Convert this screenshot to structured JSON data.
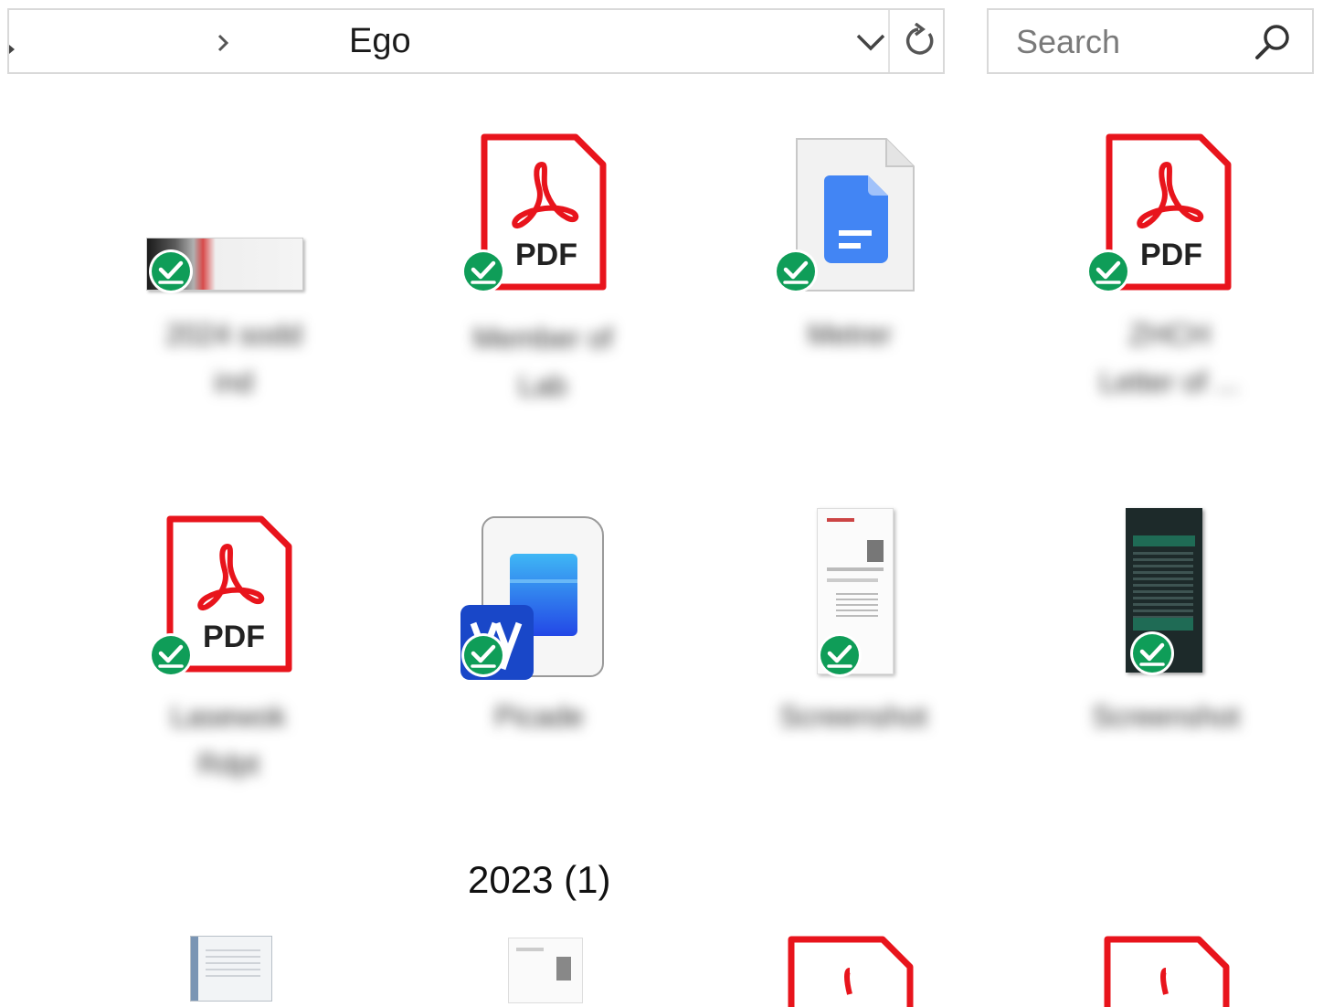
{
  "address": {
    "breadcrumb": "Ego"
  },
  "search": {
    "placeholder": "Search"
  },
  "files": [
    {
      "type": "image",
      "name": "2024  sodd\nind"
    },
    {
      "type": "pdf",
      "badge": "PDF",
      "name": "Member of\nLab"
    },
    {
      "type": "gdoc",
      "name": "Metrer"
    },
    {
      "type": "pdf",
      "badge": "PDF",
      "name": "ZHCH\nLetter of ..."
    },
    {
      "type": "pdf",
      "badge": "PDF",
      "name": "Lasewok\nRdpt"
    },
    {
      "type": "app",
      "name": "Picade"
    },
    {
      "type": "screenshot",
      "name": "Screenshot"
    },
    {
      "type": "screenshot-dark",
      "name": "Screenshot"
    }
  ],
  "group": {
    "header": "2023 (1)"
  },
  "colors": {
    "pdf_red": "#e8141c",
    "sync_green": "#0f9d58",
    "gdoc_blue": "#4285f4",
    "border": "#d9d9d9"
  }
}
